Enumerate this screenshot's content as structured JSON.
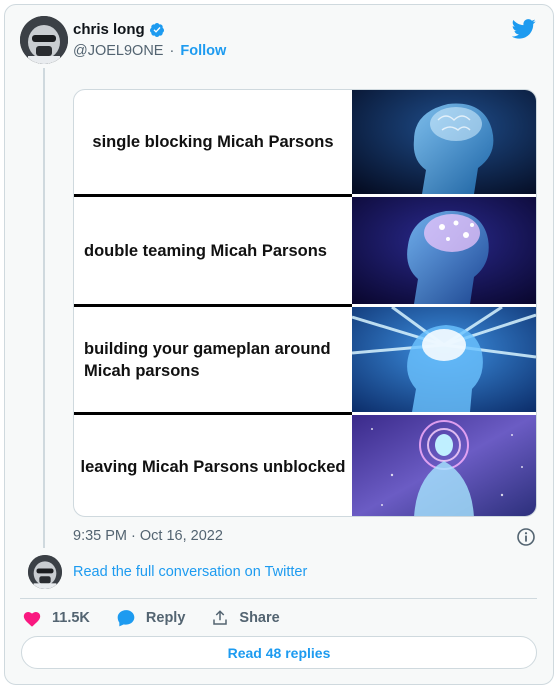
{
  "author": {
    "name": "chris long",
    "handle": "@JOEL9ONE",
    "follow_label": "Follow",
    "separator": "·"
  },
  "tweet": {
    "timestamp": "9:35 PM · Oct 16, 2022",
    "meme_panels": [
      {
        "text": "single blocking Micah Parsons"
      },
      {
        "text": "double teaming Micah Parsons"
      },
      {
        "text": "building your gameplan around Micah parsons"
      },
      {
        "text": "leaving Micah Parsons unblocked"
      }
    ]
  },
  "conversation_link": "Read the full conversation on Twitter",
  "actions": {
    "like_count": "11.5K",
    "reply_label": "Reply",
    "share_label": "Share"
  },
  "read_replies_label": "Read 48 replies",
  "colors": {
    "accent": "#1d9bf0",
    "like": "#f91880",
    "muted": "#536471"
  },
  "icons": [
    "verified-badge-icon",
    "twitter-bird-icon",
    "info-icon",
    "heart-icon",
    "reply-bubble-icon",
    "share-icon"
  ]
}
